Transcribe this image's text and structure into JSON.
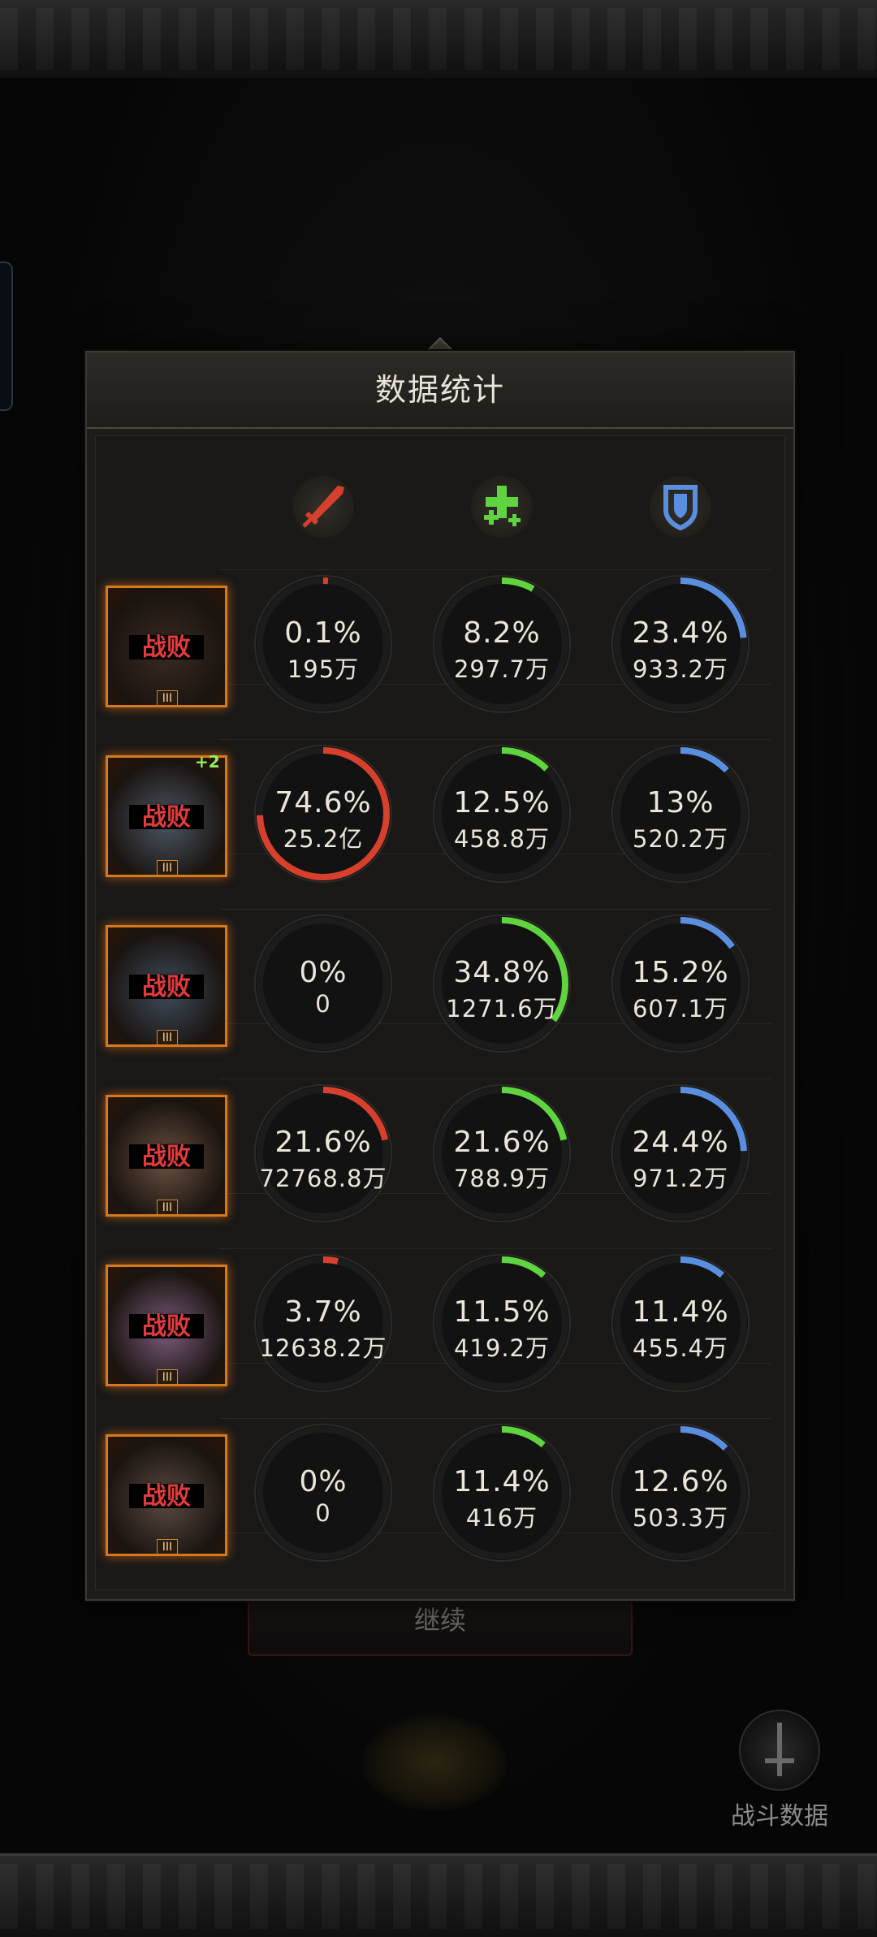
{
  "panel": {
    "title": "数据统计"
  },
  "columns": [
    {
      "icon": "sword-icon",
      "color": "#d8402e"
    },
    {
      "icon": "heal-cross-icon",
      "color": "#5fd340"
    },
    {
      "icon": "shield-icon",
      "color": "#5a8fe0"
    }
  ],
  "rows": [
    {
      "status": "战败",
      "plus": "",
      "tier": "III",
      "tint": "#3a2a22",
      "stats": [
        {
          "pct": "0.1%",
          "val": "195万",
          "fraction": 0.001
        },
        {
          "pct": "8.2%",
          "val": "297.7万",
          "fraction": 0.082
        },
        {
          "pct": "23.4%",
          "val": "933.2万",
          "fraction": 0.234
        }
      ]
    },
    {
      "status": "战败",
      "plus": "+2",
      "tier": "III",
      "tint": "#4c5664",
      "stats": [
        {
          "pct": "74.6%",
          "val": "25.2亿",
          "fraction": 0.746
        },
        {
          "pct": "12.5%",
          "val": "458.8万",
          "fraction": 0.125
        },
        {
          "pct": "13%",
          "val": "520.2万",
          "fraction": 0.13
        }
      ]
    },
    {
      "status": "战败",
      "plus": "",
      "tier": "III",
      "tint": "#3e4c5c",
      "stats": [
        {
          "pct": "0%",
          "val": "0",
          "fraction": 0
        },
        {
          "pct": "34.8%",
          "val": "1271.6万",
          "fraction": 0.348
        },
        {
          "pct": "15.2%",
          "val": "607.1万",
          "fraction": 0.152
        }
      ]
    },
    {
      "status": "战败",
      "plus": "",
      "tier": "III",
      "tint": "#6a5040",
      "stats": [
        {
          "pct": "21.6%",
          "val": "72768.8万",
          "fraction": 0.216
        },
        {
          "pct": "21.6%",
          "val": "788.9万",
          "fraction": 0.216
        },
        {
          "pct": "24.4%",
          "val": "971.2万",
          "fraction": 0.244
        }
      ]
    },
    {
      "status": "战败",
      "plus": "",
      "tier": "III",
      "tint": "#7a5a7a",
      "stats": [
        {
          "pct": "3.7%",
          "val": "12638.2万",
          "fraction": 0.037
        },
        {
          "pct": "11.5%",
          "val": "419.2万",
          "fraction": 0.115
        },
        {
          "pct": "11.4%",
          "val": "455.4万",
          "fraction": 0.114
        }
      ]
    },
    {
      "status": "战败",
      "plus": "",
      "tier": "III",
      "tint": "#5a4a42",
      "stats": [
        {
          "pct": "0%",
          "val": "0",
          "fraction": 0
        },
        {
          "pct": "11.4%",
          "val": "416万",
          "fraction": 0.114
        },
        {
          "pct": "12.6%",
          "val": "503.3万",
          "fraction": 0.126
        }
      ]
    }
  ],
  "continue_label": "继续",
  "battle_data_label": "战斗数据"
}
